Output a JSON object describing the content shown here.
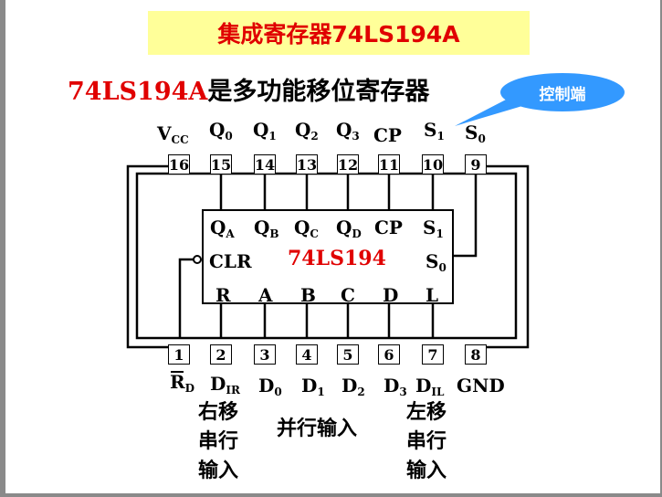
{
  "title": "集成寄存器74LS194A",
  "subtitle": {
    "part1": "74LS194A",
    "part2": "是多功能移位寄存器"
  },
  "callout": "控制端",
  "chip_name": "74LS194",
  "top_pins": [
    {
      "num": "16",
      "label": "V",
      "sub": "CC"
    },
    {
      "num": "15",
      "label": "Q",
      "sub": "0"
    },
    {
      "num": "14",
      "label": "Q",
      "sub": "1"
    },
    {
      "num": "13",
      "label": "Q",
      "sub": "2"
    },
    {
      "num": "12",
      "label": "Q",
      "sub": "3"
    },
    {
      "num": "11",
      "label": "CP",
      "sub": ""
    },
    {
      "num": "10",
      "label": "S",
      "sub": "1"
    },
    {
      "num": "9",
      "label": "S",
      "sub": "0"
    }
  ],
  "bottom_pins": [
    {
      "num": "1",
      "label": "R",
      "sub": "D"
    },
    {
      "num": "2",
      "label": "D",
      "sub": "IR"
    },
    {
      "num": "3",
      "label": "D",
      "sub": "0"
    },
    {
      "num": "4",
      "label": "D",
      "sub": "1"
    },
    {
      "num": "5",
      "label": "D",
      "sub": "2"
    },
    {
      "num": "6",
      "label": "D",
      "sub": "3"
    },
    {
      "num": "7",
      "label": "D",
      "sub": "IL"
    },
    {
      "num": "8",
      "label": "GND",
      "sub": ""
    }
  ],
  "inner_top": [
    {
      "label": "Q",
      "sub": "A"
    },
    {
      "label": "Q",
      "sub": "B"
    },
    {
      "label": "Q",
      "sub": "C"
    },
    {
      "label": "Q",
      "sub": "D"
    },
    {
      "label": "CP",
      "sub": ""
    },
    {
      "label": "S",
      "sub": "1"
    }
  ],
  "inner_mid": {
    "clr": "CLR",
    "s0": "S",
    "s0_sub": "0"
  },
  "inner_bottom": [
    "R",
    "A",
    "B",
    "C",
    "D",
    "L"
  ],
  "notes": {
    "right_serial": [
      "右移",
      "串行",
      "输入"
    ],
    "parallel": "并行输入",
    "left_serial": [
      "左移",
      "串行",
      "输入"
    ]
  }
}
